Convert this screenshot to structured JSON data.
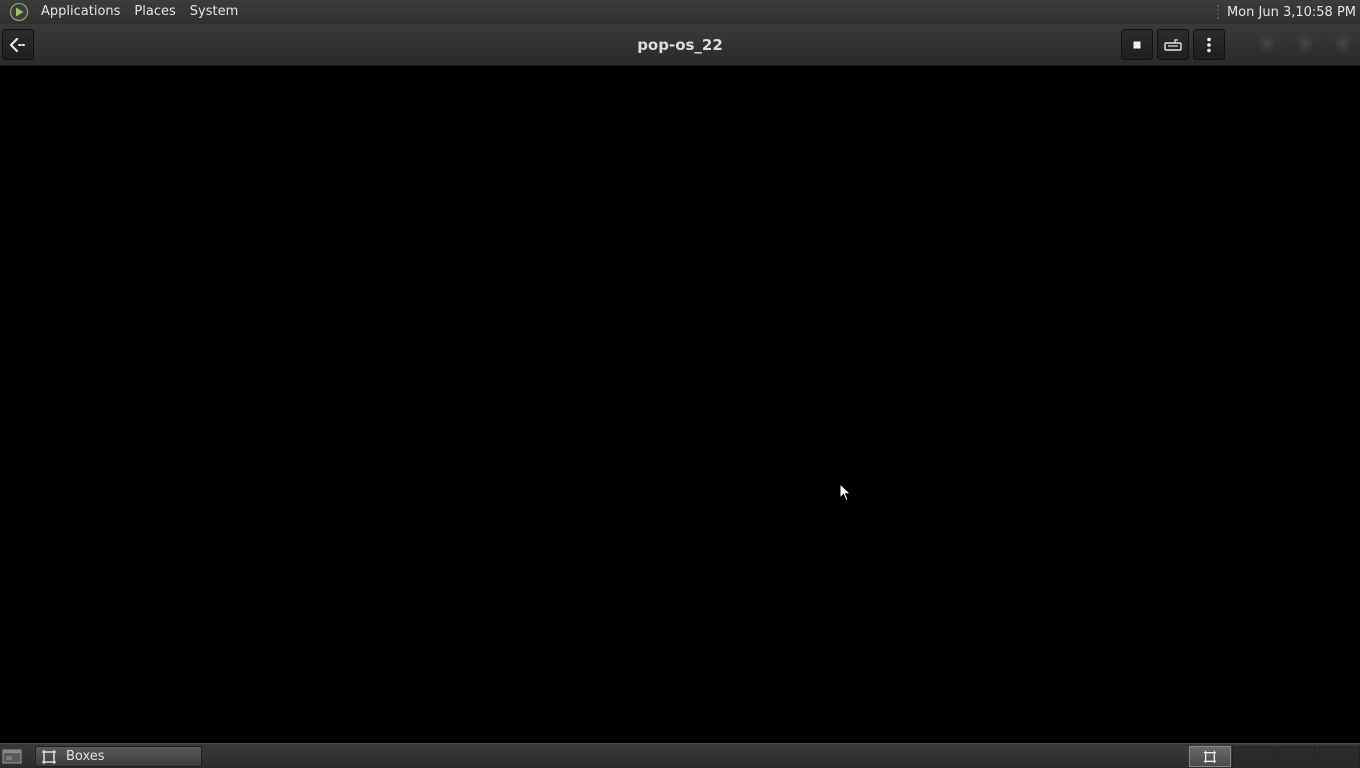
{
  "top_panel": {
    "logo_icon": "distro-logo-icon",
    "menus": [
      "Applications",
      "Places",
      "System"
    ],
    "clock": "Mon Jun  3,10:58 PM"
  },
  "header": {
    "title": "pop-os_22",
    "back_icon": "back-arrow-icon",
    "buttons": [
      {
        "name": "send-keys-button",
        "icon": "stop-square-icon"
      },
      {
        "name": "keyboard-button",
        "icon": "keyboard-icon"
      },
      {
        "name": "menu-button",
        "icon": "vertical-dots-icon"
      }
    ],
    "window_controls": [
      "minimize",
      "maximize",
      "close"
    ]
  },
  "display": {
    "background": "#000000",
    "cursor_icon": "mouse-pointer-icon"
  },
  "bottom_panel": {
    "show_desktop_icon": "show-desktop-icon",
    "tasks": [
      {
        "label": "Boxes",
        "icon": "boxes-app-icon"
      }
    ],
    "workspaces": 4,
    "active_workspace": 1
  },
  "colors": {
    "panel_bg": "#333333",
    "header_bg": "#2e2e2e",
    "text": "#e6e6e6"
  }
}
